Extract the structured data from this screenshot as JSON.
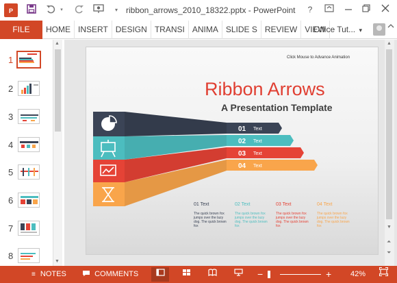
{
  "window": {
    "title": "ribbon_arrows_2010_18322.pptx - PowerPoint",
    "logo_letter": "P",
    "help_label": "?",
    "ribbon_display_icon": "ribbon-display-options-icon",
    "minimize_icon": "minimize-icon",
    "restore_icon": "restore-icon",
    "close_icon": "close-icon"
  },
  "qat": {
    "save_icon": "save-icon",
    "undo_icon": "undo-icon",
    "redo_icon": "redo-icon",
    "present_icon": "present-from-start-icon"
  },
  "ribbon": {
    "file_label": "FILE",
    "tabs": [
      {
        "label": "HOME"
      },
      {
        "label": "INSERT"
      },
      {
        "label": "DESIGN"
      },
      {
        "label": "TRANSI"
      },
      {
        "label": "ANIMA"
      },
      {
        "label": "SLIDE S"
      },
      {
        "label": "REVIEW"
      },
      {
        "label": "VIEW"
      }
    ],
    "account_name": "Office Tut...",
    "account_dropdown": "▾",
    "collapse_icon": "chevron-up-icon"
  },
  "thumbnails": [
    {
      "number": "1",
      "active": true
    },
    {
      "number": "2",
      "active": false
    },
    {
      "number": "3",
      "active": false
    },
    {
      "number": "4",
      "active": false
    },
    {
      "number": "5",
      "active": false
    },
    {
      "number": "6",
      "active": false
    },
    {
      "number": "7",
      "active": false
    },
    {
      "number": "8",
      "active": false
    }
  ],
  "slide": {
    "hint": "Click Mouse to Advance Animation",
    "title": "Ribbon Arrows",
    "subtitle": "A Presentation Template",
    "arrows": [
      {
        "number": "01",
        "text": "Text",
        "color": "#3b4456",
        "icon": "pie-chart-icon"
      },
      {
        "number": "02",
        "text": "Text",
        "color": "#4cbdbf",
        "icon": "presentation-easel-icon"
      },
      {
        "number": "03",
        "text": "Text",
        "color": "#e54336",
        "icon": "line-chart-icon"
      },
      {
        "number": "04",
        "text": "Text",
        "color": "#f9a54b",
        "icon": "hourglass-icon"
      }
    ],
    "columns": [
      {
        "heading": "01 Text",
        "body": "The quick brown fox jumps over the lazy dog. The quick brown fox",
        "color": "#3b4456"
      },
      {
        "heading": "02 Text",
        "body": "The quick brown fox jumps over the lazy dog. The quick brown fox",
        "color": "#4cbdbf"
      },
      {
        "heading": "03 Text",
        "body": "The quick brown fox jumps over the lazy dog. The quick brown fox",
        "color": "#e54336"
      },
      {
        "heading": "04 Text",
        "body": "The quick brown fox jumps over the lazy dog. The quick brown fox",
        "color": "#f9a54b"
      }
    ]
  },
  "statusbar": {
    "notes_label": "NOTES",
    "comments_label": "COMMENTS",
    "zoom_minus": "−",
    "zoom_plus": "+",
    "zoom_level": "42%",
    "zoom_fraction": 0.42,
    "view_icons": [
      "normal-view-icon",
      "slide-sorter-icon",
      "reading-view-icon",
      "slide-show-icon"
    ],
    "fit_icon": "fit-slide-icon"
  },
  "colors": {
    "accent": "#d24726",
    "statusbar": "#d24726",
    "title_red": "#e03f32"
  }
}
